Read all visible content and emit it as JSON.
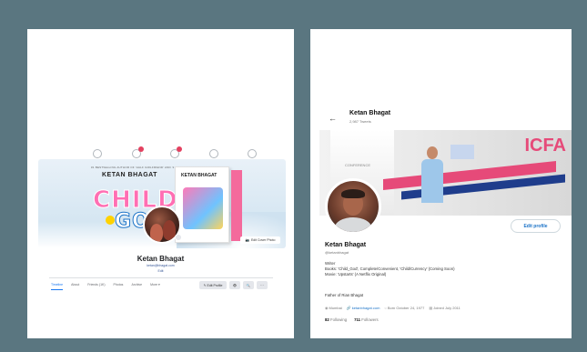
{
  "facebook": {
    "nav_icons": [
      {
        "name": "home-icon",
        "badge": false
      },
      {
        "name": "friends-icon",
        "badge": true
      },
      {
        "name": "messages-icon",
        "badge": true
      },
      {
        "name": "groups-icon",
        "badge": false
      },
      {
        "name": "notifications-icon",
        "badge": false
      }
    ],
    "cover": {
      "tagline": "#1 BESTSELLING AUTHOR OF 'HALF GIRLFRIEND' AND '2 STATES'",
      "book_title": "KETAN BHAGAT",
      "big_word_1": "CHILD",
      "big_word_2": "GOD",
      "book_cover_title": "KETAN BHAGAT",
      "edit_cover_label": "Edit Cover Photo"
    },
    "profile": {
      "name": "Ketan Bhagat",
      "email": "ketan@bhagat.com",
      "edit_label": "Edit"
    },
    "tabs": [
      "Timeline",
      "About",
      "Friends (1K)",
      "Photos",
      "Archive",
      "More ▾"
    ],
    "active_tab": 0,
    "actions": {
      "edit_profile": "✎ Edit Profile",
      "view": "👁",
      "search": "🔍",
      "more": "···"
    }
  },
  "twitter": {
    "back_label": "←",
    "header_name": "Ketan Bhagat",
    "tweet_count": "2,987 Tweets",
    "banner": {
      "brand": "ICFA",
      "pillar_text": "CONFERENCE"
    },
    "edit_profile_label": "Edit profile",
    "name": "Ketan Bhagat",
    "handle": "@ketanbhagat",
    "bio": [
      "Writer",
      "Books: 'Child_God', Complete/Convenient, 'Child/Currency' (Coming Soon)",
      "Movie: 'Upstarts' (A Netflix Original)"
    ],
    "father_line": "Father of Rian Bhagat",
    "meta": {
      "location": "Mumbai",
      "website": "ketanbhagat.com",
      "born": "Born October 24, 1977",
      "joined": "Joined July 2011"
    },
    "following_count": "82",
    "following_label": "Following",
    "followers_count": "711",
    "followers_label": "Followers"
  }
}
